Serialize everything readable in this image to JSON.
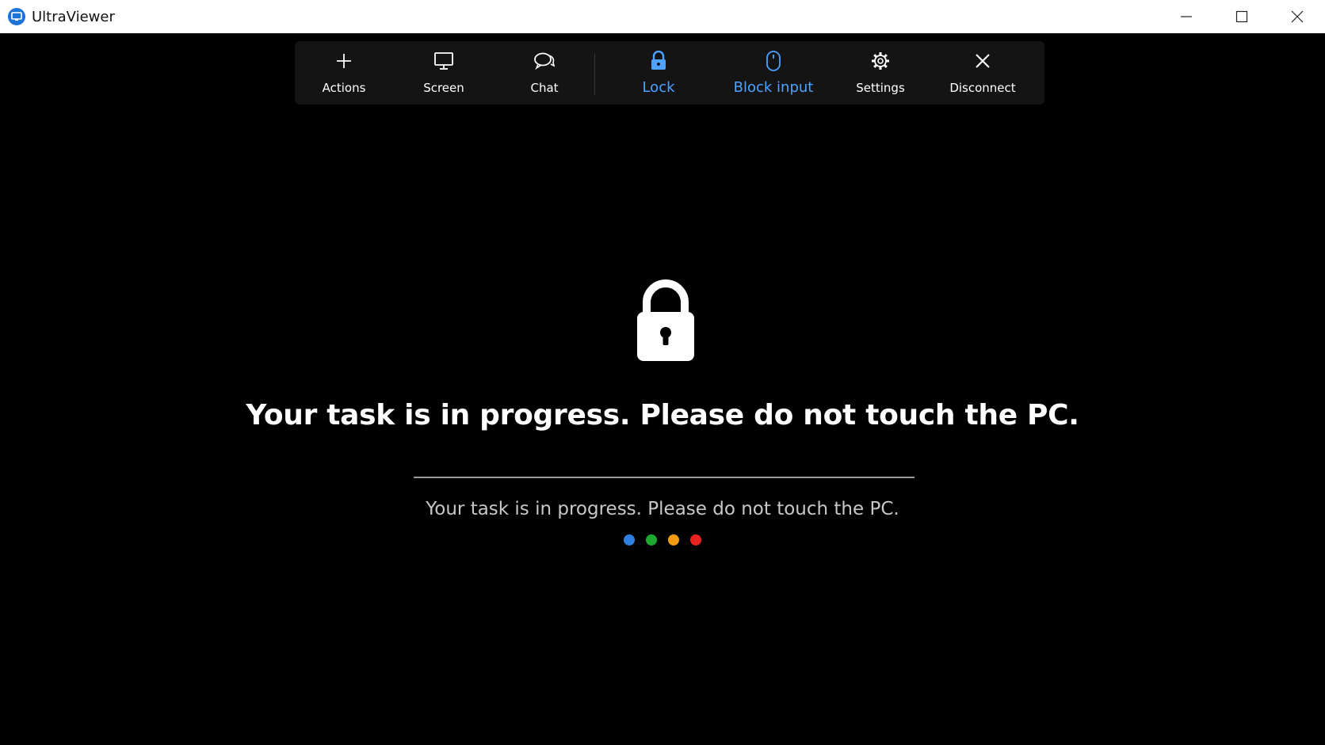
{
  "window": {
    "title": "UltraViewer",
    "controls": [
      "minimize-icon",
      "maximize-icon",
      "close-icon"
    ]
  },
  "toolbar": {
    "items": [
      {
        "label": "Actions",
        "icon": "plus-icon",
        "active": false
      },
      {
        "label": "Screen",
        "icon": "monitor-icon",
        "active": false
      },
      {
        "label": "Chat",
        "icon": "chat-bubbles-icon",
        "active": false
      },
      {
        "label": "Lock",
        "icon": "lock-icon",
        "active": true
      },
      {
        "label": "Block input",
        "icon": "mouse-icon",
        "active": true
      },
      {
        "label": "Settings",
        "icon": "gear-icon",
        "active": false
      },
      {
        "label": "Disconnect",
        "icon": "x-icon",
        "active": false
      }
    ],
    "active_color": "#4da3ff"
  },
  "main": {
    "headline": "Your task is in progress. Please do not touch the PC.",
    "subline": "Your task is in progress. Please do not touch the PC.",
    "progress_dot_colors": [
      "#2f7fe0",
      "#1fa831",
      "#f29a10",
      "#e8221e"
    ]
  }
}
